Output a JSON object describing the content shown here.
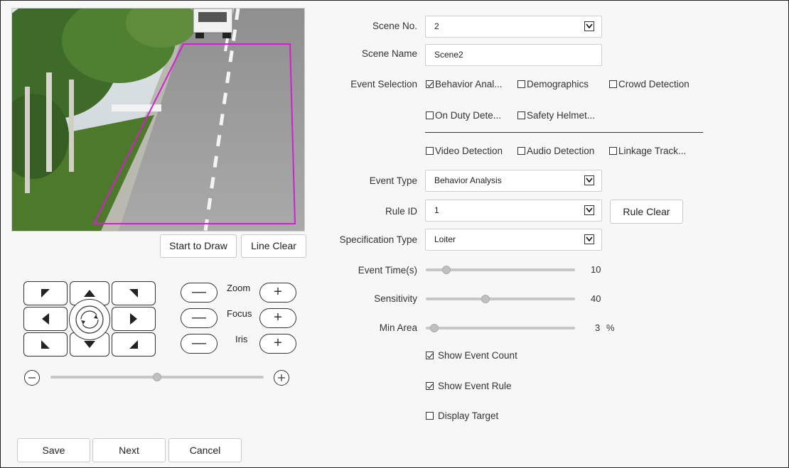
{
  "video": {
    "description_icon": "camera-preview"
  },
  "draw_buttons": {
    "start": "Start to Draw",
    "clear": "Line Clear"
  },
  "ptz": {
    "zoom_label": "Zoom",
    "focus_label": "Focus",
    "iris_label": "Iris",
    "minus": "—",
    "plus": "+",
    "speed_level": 0.5
  },
  "form": {
    "scene_no": {
      "label": "Scene No.",
      "value": "2"
    },
    "scene_name": {
      "label": "Scene Name",
      "value": "Scene2"
    },
    "event_selection": {
      "label": "Event Selection",
      "options": [
        {
          "text": "Behavior Anal...",
          "checked": true
        },
        {
          "text": "Demographics",
          "checked": false
        },
        {
          "text": "Crowd Detection",
          "checked": false
        },
        {
          "text": "On Duty Dete...",
          "checked": false
        },
        {
          "text": "Safety Helmet...",
          "checked": false
        },
        {
          "text": "Video Detection",
          "checked": false
        },
        {
          "text": "Audio Detection",
          "checked": false
        },
        {
          "text": "Linkage Track...",
          "checked": false
        }
      ]
    },
    "event_type": {
      "label": "Event Type",
      "value": "Behavior Analysis"
    },
    "rule_id": {
      "label": "Rule ID",
      "value": "1",
      "clear_button": "Rule Clear"
    },
    "spec_type": {
      "label": "Specification Type",
      "value": "Loiter"
    },
    "event_time": {
      "label": "Event Time(s)",
      "value": "10",
      "level": 0.14
    },
    "sensitivity": {
      "label": "Sensitivity",
      "value": "40",
      "level": 0.4
    },
    "min_area": {
      "label": "Min Area",
      "value": "3",
      "unit": "%",
      "level": 0.03
    },
    "show_event_count": {
      "label": "Show Event Count",
      "checked": true
    },
    "show_event_rule": {
      "label": "Show Event Rule",
      "checked": true
    },
    "display_target": {
      "label": "Display Target",
      "checked": false
    }
  },
  "footer": {
    "save": "Save",
    "next": "Next",
    "cancel": "Cancel"
  },
  "colors": {
    "roi_line": "#d020d0",
    "road": "#a7a7a7"
  }
}
